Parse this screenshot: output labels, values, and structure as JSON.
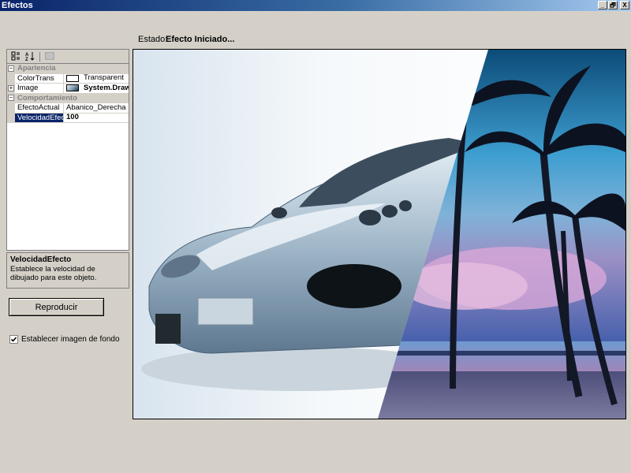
{
  "window": {
    "title": "Efectos",
    "buttons": [
      "_",
      "🗗",
      "X"
    ]
  },
  "status": {
    "label": "Estado:",
    "value": "Efecto Iniciado..."
  },
  "property_grid": {
    "toolbar": [
      "categorized-icon",
      "alphabetical-icon",
      "property-pages-icon"
    ],
    "categories": [
      {
        "name": "Apariencia",
        "properties": [
          {
            "name": "ColorTrans",
            "value": "Transparent"
          },
          {
            "name": "Image",
            "value": "System.Drawi"
          }
        ]
      },
      {
        "name": "Comportamiento",
        "properties": [
          {
            "name": "EfectoActual",
            "value": "Abanico_Derecha"
          },
          {
            "name": "VelocidadEfect",
            "value": "100"
          }
        ]
      }
    ]
  },
  "description": {
    "title": "VelocidadEfecto",
    "text": "Establece la velocidad de dibujado para este objeto."
  },
  "play_button": {
    "label": "Reproducir"
  },
  "background_checkbox": {
    "label": "Establecer imagen de fondo",
    "checked": true
  },
  "viewer": {
    "left_image": "silver-sports-car",
    "right_image": "tropical-beach-palms"
  }
}
